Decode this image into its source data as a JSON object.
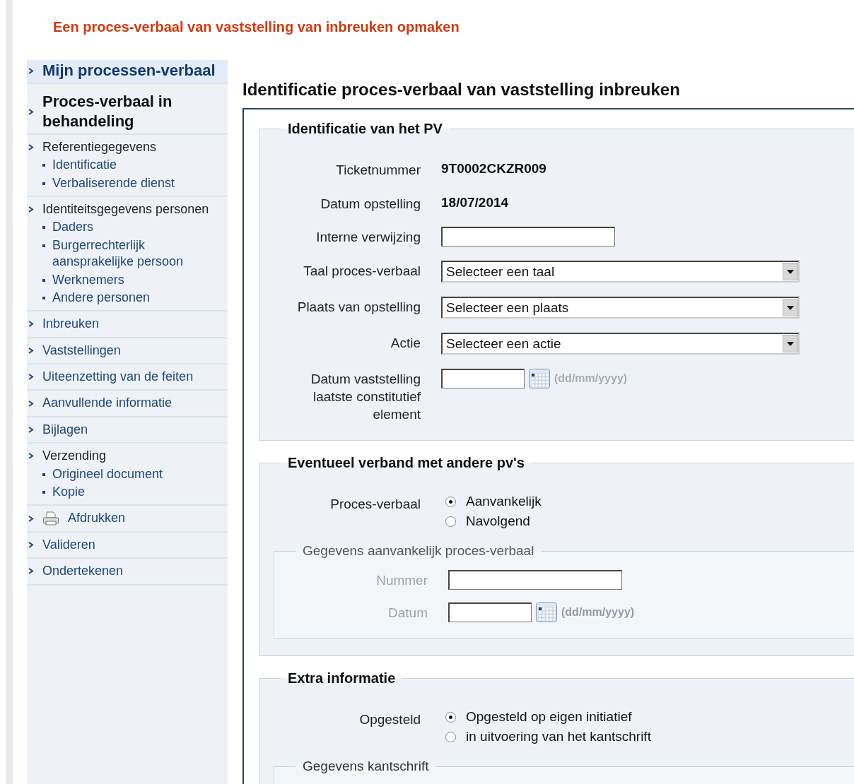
{
  "page_title": "Een proces-verbaal van vaststelling van inbreuken opmaken",
  "sidebar": {
    "items": [
      {
        "kind": "primary",
        "label": "Mijn processen-verbaal"
      },
      {
        "kind": "current",
        "label": "Proces-verbaal in behandeling"
      },
      {
        "kind": "group",
        "label": "Referentiegegevens",
        "children": [
          {
            "label": "Identificatie"
          },
          {
            "label": "Verbaliserende dienst"
          }
        ]
      },
      {
        "kind": "group",
        "label": "Identiteitsgegevens personen",
        "children": [
          {
            "label": "Daders"
          },
          {
            "label": "Burgerrechterlijk aansprakelijke persoon"
          },
          {
            "label": "Werknemers"
          },
          {
            "label": "Andere personen"
          }
        ]
      },
      {
        "kind": "link",
        "label": "Inbreuken"
      },
      {
        "kind": "link",
        "label": "Vaststellingen"
      },
      {
        "kind": "link",
        "label": "Uiteenzetting van de feiten"
      },
      {
        "kind": "link",
        "label": "Aanvullende informatie"
      },
      {
        "kind": "link",
        "label": "Bijlagen"
      },
      {
        "kind": "group",
        "label": "Verzending",
        "children": [
          {
            "label": "Origineel document"
          },
          {
            "label": "Kopie"
          }
        ]
      },
      {
        "kind": "print",
        "label": "Afdrukken"
      },
      {
        "kind": "link",
        "label": "Valideren"
      },
      {
        "kind": "link",
        "label": "Ondertekenen"
      }
    ]
  },
  "form": {
    "heading": "Identificatie proces-verbaal van vaststelling inbreuken",
    "sections": [
      {
        "legend": "Identificatie van het PV",
        "rows": [
          {
            "kind": "static",
            "label": "Ticketnummer",
            "value": "9T0002CKZR009"
          },
          {
            "kind": "static",
            "label": "Datum opstelling",
            "value": "18/07/2014"
          },
          {
            "kind": "text",
            "label": "Interne verwijzing"
          },
          {
            "kind": "select",
            "label": "Taal proces-verbaal",
            "value": "Selecteer een taal"
          },
          {
            "kind": "select",
            "label": "Plaats van opstelling",
            "value": "Selecteer een plaats"
          },
          {
            "kind": "select",
            "label": "Actie",
            "value": "Selecteer een actie"
          },
          {
            "kind": "date",
            "label": "Datum vaststelling laatste constitutief element",
            "hint": "(dd/mm/yyyy)"
          }
        ]
      },
      {
        "legend": "Eventueel verband met andere pv's",
        "rows": [
          {
            "kind": "radio",
            "label": "Proces-verbaal",
            "options": [
              {
                "label": "Aanvankelijk",
                "selected": true
              },
              {
                "label": "Navolgend",
                "selected": false
              }
            ]
          }
        ],
        "subsection": {
          "legend": "Gegevens aanvankelijk proces-verbaal",
          "disabled": true,
          "rows": [
            {
              "kind": "text",
              "label": "Nummer"
            },
            {
              "kind": "date",
              "label": "Datum",
              "hint": "(dd/mm/yyyy)"
            }
          ]
        }
      },
      {
        "legend": "Extra informatie",
        "rows": [
          {
            "kind": "radio",
            "label": "Opgesteld",
            "options": [
              {
                "label": "Opgesteld op eigen initiatief",
                "selected": true
              },
              {
                "label": "in uitvoering van het kantschrift",
                "selected": false
              }
            ]
          }
        ],
        "subsection": {
          "legend": "Gegevens kantschrift"
        }
      }
    ]
  }
}
